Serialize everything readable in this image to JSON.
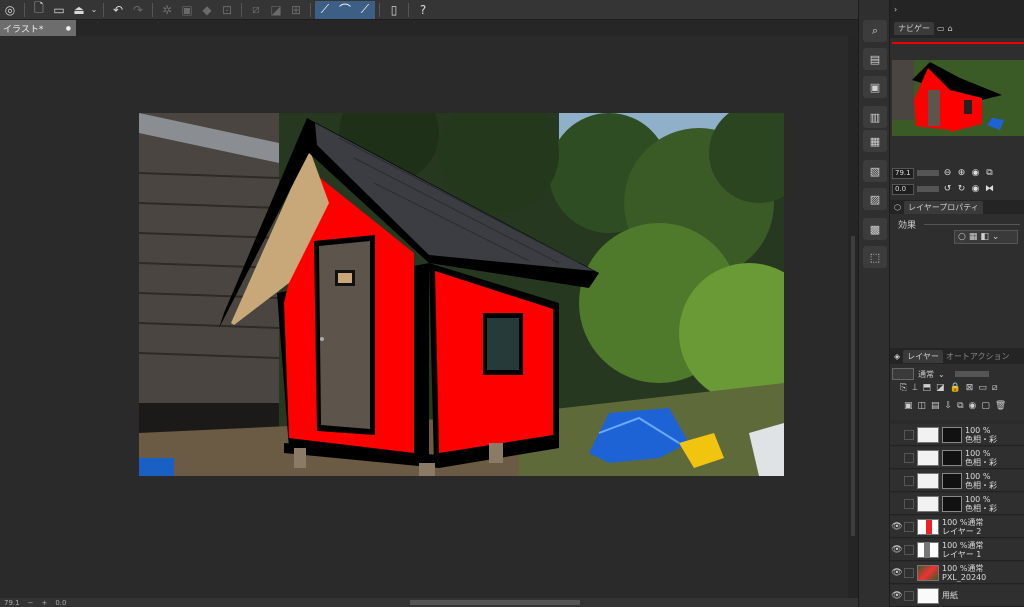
{
  "toolbar": {
    "icons": [
      "app-menu-icon",
      "new-file-icon",
      "open-folder-icon",
      "save-icon",
      "undo-icon",
      "redo-icon",
      "transform-icon",
      "clear-icon",
      "fill-icon",
      "crop-icon",
      "invert-icon",
      "deselect-icon",
      "snap-ruler-icon",
      "snap-special-icon",
      "snap-grid-icon",
      "phone-icon",
      "help-icon"
    ]
  },
  "tab": {
    "title": "イラスト*",
    "close": "●"
  },
  "navigator": {
    "tabs": [
      "ナビゲー",
      "",
      ""
    ],
    "zoom": "79.1",
    "rotate": "0.0"
  },
  "layer_property": {
    "title": "レイヤープロパティ",
    "effect_label": "効果"
  },
  "layers_panel": {
    "tabs": [
      "レイヤー",
      "オートアクション"
    ],
    "blend_mode": "通常"
  },
  "layers": [
    {
      "opacity": "100 %",
      "name": "色相・彩",
      "kind": "adjust"
    },
    {
      "opacity": "100 %",
      "name": "色相・彩",
      "kind": "adjust"
    },
    {
      "opacity": "100 %",
      "name": "色相・彩",
      "kind": "adjust"
    },
    {
      "opacity": "100 %",
      "name": "色相・彩",
      "kind": "adjust"
    },
    {
      "opacity": "100 %通常",
      "name": "レイヤー 2",
      "kind": "paint"
    },
    {
      "opacity": "100 %通常",
      "name": "レイヤー 1",
      "kind": "paint"
    },
    {
      "opacity": "100 %通常",
      "name": "PXL_20240",
      "kind": "photo"
    },
    {
      "opacity": "",
      "name": "用紙",
      "kind": "paper"
    }
  ],
  "status": {
    "zoom": "79.1",
    "angle": "0.0"
  },
  "colors": {
    "accent": "#3d5f86",
    "house_red": "#ff0000",
    "roof": "#2e2f33",
    "tarp": "#1e63d6",
    "basket": "#f1c40f"
  }
}
